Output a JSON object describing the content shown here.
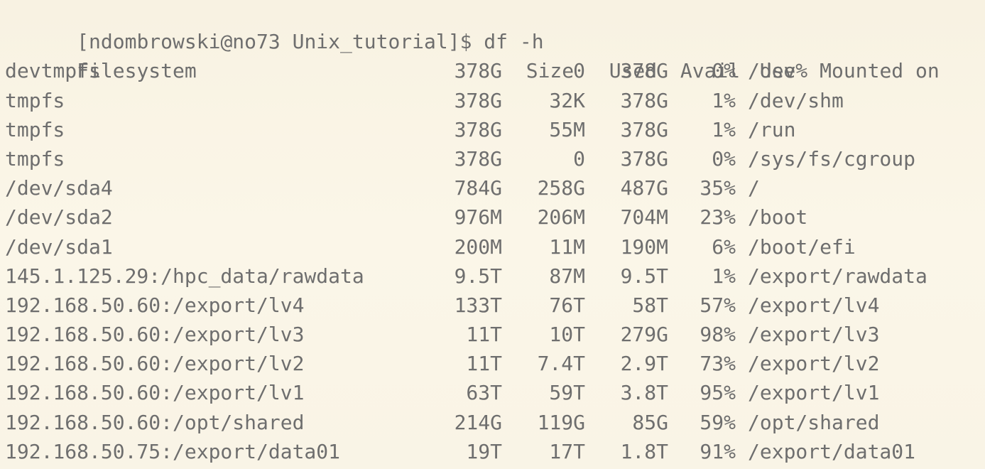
{
  "prompt": {
    "text": "[ndombrowski@no73 Unix_tutorial]$ df -h"
  },
  "table": {
    "columns": [
      "Filesystem",
      "Size",
      "Used",
      "Avail",
      "Use%",
      "Mounted on"
    ],
    "rows": [
      [
        "devtmpfs",
        "378G",
        "0",
        "378G",
        "0%",
        "/dev"
      ],
      [
        "tmpfs",
        "378G",
        "32K",
        "378G",
        "1%",
        "/dev/shm"
      ],
      [
        "tmpfs",
        "378G",
        "55M",
        "378G",
        "1%",
        "/run"
      ],
      [
        "tmpfs",
        "378G",
        "0",
        "378G",
        "0%",
        "/sys/fs/cgroup"
      ],
      [
        "/dev/sda4",
        "784G",
        "258G",
        "487G",
        "35%",
        "/"
      ],
      [
        "/dev/sda2",
        "976M",
        "206M",
        "704M",
        "23%",
        "/boot"
      ],
      [
        "/dev/sda1",
        "200M",
        "11M",
        "190M",
        "6%",
        "/boot/efi"
      ],
      [
        "145.1.125.29:/hpc_data/rawdata",
        "9.5T",
        "87M",
        "9.5T",
        "1%",
        "/export/rawdata"
      ],
      [
        "192.168.50.60:/export/lv4",
        "133T",
        "76T",
        "58T",
        "57%",
        "/export/lv4"
      ],
      [
        "192.168.50.60:/export/lv3",
        "11T",
        "10T",
        "279G",
        "98%",
        "/export/lv3"
      ],
      [
        "192.168.50.60:/export/lv2",
        "11T",
        "7.4T",
        "2.9T",
        "73%",
        "/export/lv2"
      ],
      [
        "192.168.50.60:/export/lv1",
        "63T",
        "59T",
        "3.8T",
        "95%",
        "/export/lv1"
      ],
      [
        "192.168.50.60:/opt/shared",
        "214G",
        "119G",
        "85G",
        "59%",
        "/opt/shared"
      ],
      [
        "192.168.50.75:/export/data01",
        "19T",
        "17T",
        "1.8T",
        "91%",
        "/export/data01"
      ]
    ]
  }
}
